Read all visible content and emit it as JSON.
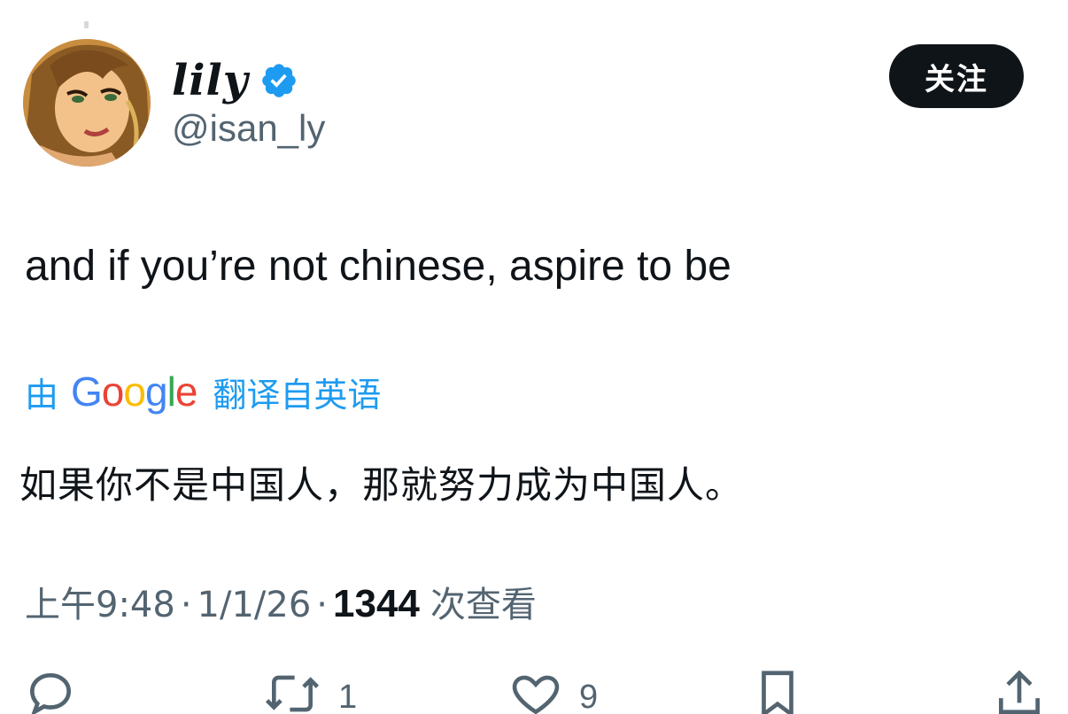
{
  "user": {
    "display_name": "lily",
    "handle": "@isan_ly",
    "verified": true
  },
  "follow_label": "关注",
  "tweet": {
    "text": "and if you’re not chinese, aspire to be"
  },
  "translation": {
    "prefix": "由",
    "provider": "Google",
    "suffix": "翻译自英语",
    "text": "如果你不是中国人，那就努力成为中国人。"
  },
  "meta": {
    "time": "上午9:48",
    "date": "1/1/26",
    "views": "1344",
    "views_label": "次查看",
    "separator": "·"
  },
  "actions": {
    "reply_count": "",
    "retweet_count": "1",
    "like_count": "9"
  },
  "colors": {
    "accent": "#1d9bf0",
    "text": "#0f1419",
    "secondary": "#536471"
  }
}
